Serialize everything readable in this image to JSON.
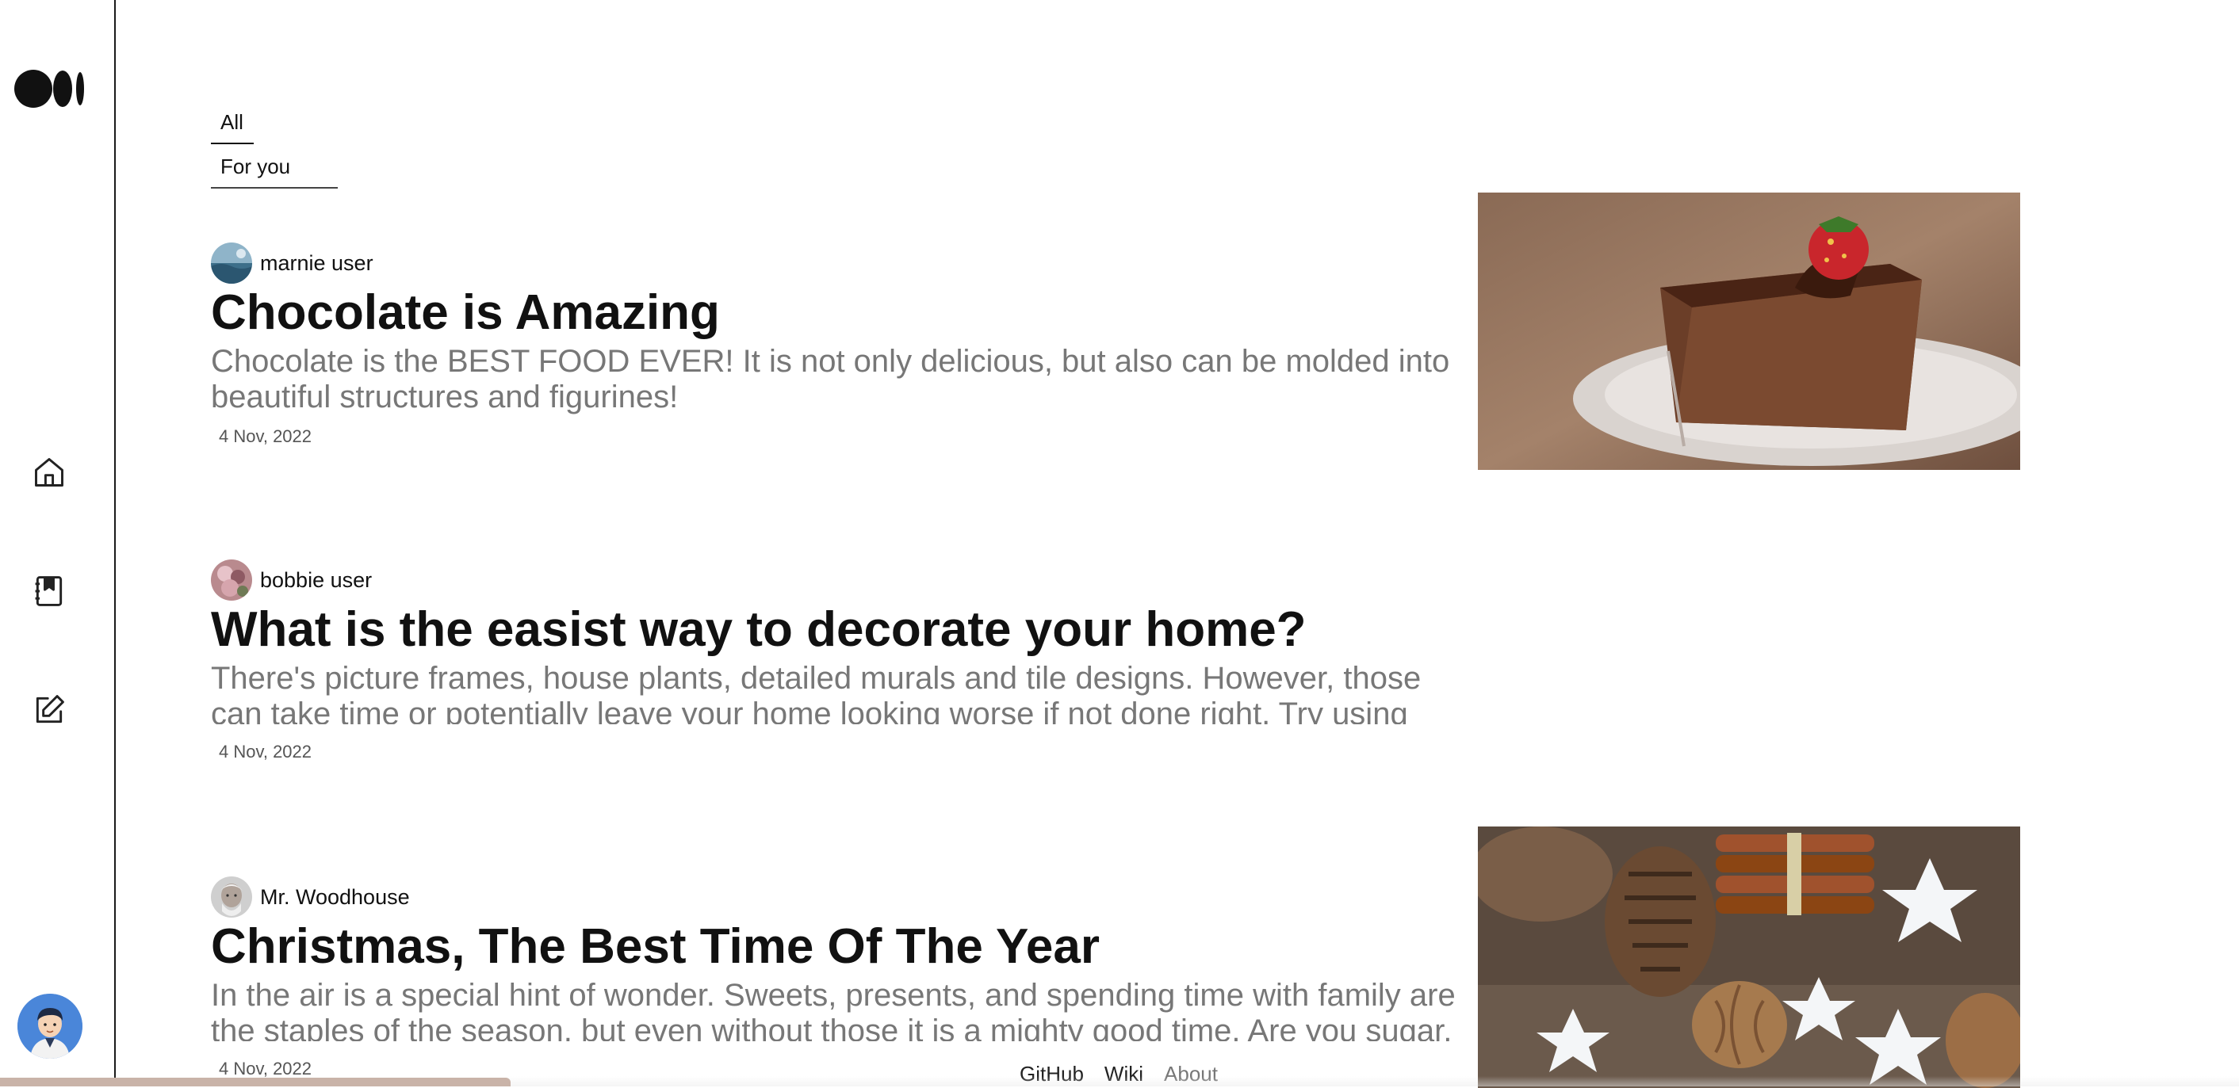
{
  "sidebar": {
    "logo": "medium-logo",
    "nav": [
      {
        "icon": "home-icon"
      },
      {
        "icon": "bookmarks-icon"
      },
      {
        "icon": "write-icon"
      }
    ],
    "profile_icon": "user-avatar-icon"
  },
  "tabs": [
    {
      "label": "All"
    },
    {
      "label": "For you"
    }
  ],
  "articles": [
    {
      "author": "marnie user",
      "title": "Chocolate is Amazing",
      "excerpt": "Chocolate is the BEST FOOD EVER! It is not only delicious, but also can be molded into beautiful structures and figurines!",
      "date": "4 Nov, 2022",
      "image": "chocolate-cake-with-strawberry"
    },
    {
      "author": "bobbie user",
      "title": "What is the easist way to decorate your home?",
      "excerpt": "There's picture frames, house plants, detailed murals and tile designs. However, those can take time or potentially leave your home looking worse if not done right. Try using",
      "date": "4 Nov, 2022"
    },
    {
      "author": "Mr. Woodhouse",
      "title": "Christmas, The Best Time Of The Year",
      "excerpt": "In the air is a special hint of wonder. Sweets, presents, and spending time with family are the staples of the season, but even without those it is a mighty good time. Are you sugar,",
      "date": "4 Nov, 2022",
      "image": "christmas-cookies-pinecones-cinnamon"
    }
  ],
  "footer": {
    "links": [
      "GitHub",
      "Wiki",
      "About"
    ]
  },
  "colors": {
    "excerpt": "#777777",
    "title": "#111111",
    "sidebar_border": "#1a1a1a"
  }
}
